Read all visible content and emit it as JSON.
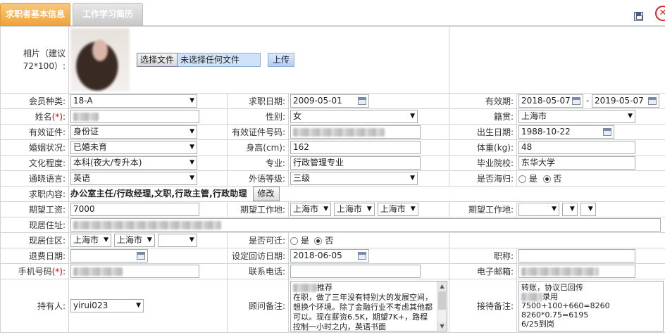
{
  "tabs": [
    {
      "label": "求职者基本信息"
    },
    {
      "label": "工作学习简历"
    }
  ],
  "toolbar": {
    "close_glyph": "✕"
  },
  "photo": {
    "label": "相片（建议72*100）:",
    "choose_file": "选择文件",
    "no_file": "未选择任何文件",
    "upload": "上传"
  },
  "form": {
    "member_type": {
      "label": "会员种类:",
      "value": "18-A"
    },
    "job_date": {
      "label": "求职日期:",
      "value": "2009-05-01"
    },
    "valid_period": {
      "label": "有效期:",
      "from": "2018-05-07",
      "sep": "-",
      "to": "2019-05-07"
    },
    "name": {
      "label": "姓名",
      "req": "(*)",
      "colon": ":"
    },
    "gender": {
      "label": "性别:",
      "value": "女"
    },
    "native_place": {
      "label": "籍贯:",
      "value": "上海市"
    },
    "id_type": {
      "label": "有效证件:",
      "value": "身份证"
    },
    "id_number": {
      "label": "有效证件号码:"
    },
    "birth_date": {
      "label": "出生日期:",
      "value": "1988-10-22"
    },
    "marital": {
      "label": "婚姻状况:",
      "value": "已婚未育"
    },
    "height": {
      "label": "身高(cm):",
      "value": "162"
    },
    "weight": {
      "label": "体重(kg):",
      "value": "48"
    },
    "education": {
      "label": "文化程度:",
      "value": "本科(夜大/专升本)"
    },
    "major": {
      "label": "专业:",
      "value": "行政管理专业"
    },
    "school": {
      "label": "毕业院校:",
      "value": "东华大学"
    },
    "language": {
      "label": "通晓语言:",
      "value": "英语"
    },
    "foreign_level": {
      "label": "外语等级:",
      "value": "三级"
    },
    "returnee": {
      "label": "是否海归:",
      "yes": "是",
      "no": "否",
      "selected": "否"
    },
    "intent": {
      "label": "求职内容:",
      "value": "办公室主任/行政经理,文职,行政主管,行政助理",
      "edit": "修改"
    },
    "salary": {
      "label": "期望工资:",
      "value": "7000"
    },
    "work_location": {
      "label": "期望工作地:",
      "p1": "上海市",
      "p2": "上海市",
      "p3": "上海市"
    },
    "work_location2": {
      "label": "期望工作地:"
    },
    "address": {
      "label": "现居住址:"
    },
    "district": {
      "label": "现居住区:",
      "p1": "上海市",
      "p2": "上海市"
    },
    "relocate": {
      "label": "是否可迁:",
      "yes": "是",
      "no": "否",
      "selected": "否"
    },
    "refund_date": {
      "label": "退费日期:"
    },
    "visit_date": {
      "label": "设定回访日期:",
      "value": "2018-06-05"
    },
    "title": {
      "label": "职称:"
    },
    "mobile": {
      "label": "手机号码",
      "req": "(*)",
      "colon": ":"
    },
    "phone": {
      "label": "联系电话:"
    },
    "email": {
      "label": "电子邮箱:"
    },
    "holder": {
      "label": "持有人:",
      "value": "yirui023"
    },
    "consultant_note": {
      "label": "顾问备注:",
      "line1": "推荐",
      "line2": "在职，做了三年没有特别大的发展空间，想换个环境。除了金融行业不考虑其他都可以。现在薪资6.5K，期望7K+，路程控制一小时之内，英语书面"
    },
    "reception_note": {
      "label": "接待备注:",
      "line1": "转账，协议已回传",
      "line2": "录用",
      "line3": "7500+100+660=8260",
      "line4": "8260*0.75=6195",
      "line5": "6/25到岗"
    }
  },
  "colors": {
    "tab_active": "#f0a33b",
    "tab_inactive": "#c8c8c8",
    "required": "#dd0000"
  },
  "icons": [
    "save-icon",
    "close-icon",
    "calendar-icon",
    "chevron-down-icon"
  ]
}
